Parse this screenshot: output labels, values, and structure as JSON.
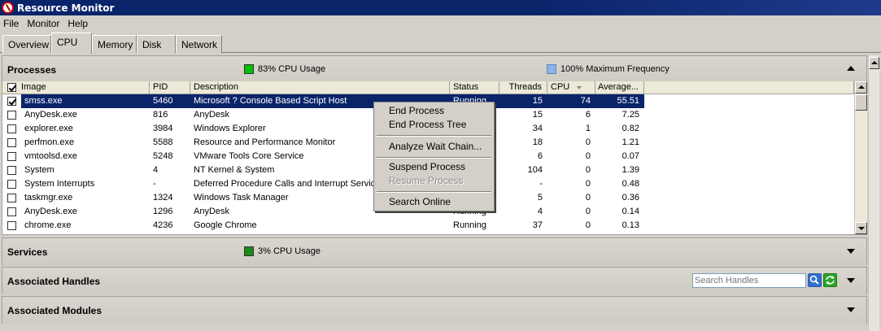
{
  "window": {
    "title": "Resource Monitor"
  },
  "menu": [
    "File",
    "Monitor",
    "Help"
  ],
  "tabs": [
    {
      "label": "Overview",
      "active": false
    },
    {
      "label": "CPU",
      "active": true
    },
    {
      "label": "Memory",
      "active": false
    },
    {
      "label": "Disk",
      "active": false
    },
    {
      "label": "Network",
      "active": false
    }
  ],
  "processes": {
    "title": "Processes",
    "cpu_usage": "83% CPU Usage",
    "cpu_usage_color": "#00c000",
    "max_frequency": "100% Maximum Frequency",
    "max_frequency_color": "#8ab4e8",
    "columns": [
      "Image",
      "PID",
      "Description",
      "Status",
      "Threads",
      "CPU",
      "Average..."
    ],
    "rows": [
      {
        "image": "smss.exe",
        "pid": "5460",
        "description": "Microsoft ? Console Based Script Host",
        "status": "Running",
        "threads": "15",
        "cpu": "74",
        "average": "55.51",
        "checked": true,
        "selected": true
      },
      {
        "image": "AnyDesk.exe",
        "pid": "816",
        "description": "AnyDesk",
        "status": "",
        "threads": "15",
        "cpu": "6",
        "average": "7.25",
        "checked": false,
        "selected": false
      },
      {
        "image": "explorer.exe",
        "pid": "3984",
        "description": "Windows Explorer",
        "status": "",
        "threads": "34",
        "cpu": "1",
        "average": "0.82",
        "checked": false,
        "selected": false
      },
      {
        "image": "perfmon.exe",
        "pid": "5588",
        "description": "Resource and Performance Monitor",
        "status": "",
        "threads": "18",
        "cpu": "0",
        "average": "1.21",
        "checked": false,
        "selected": false
      },
      {
        "image": "vmtoolsd.exe",
        "pid": "5248",
        "description": "VMware Tools Core Service",
        "status": "",
        "threads": "6",
        "cpu": "0",
        "average": "0.07",
        "checked": false,
        "selected": false
      },
      {
        "image": "System",
        "pid": "4",
        "description": "NT Kernel & System",
        "status": "",
        "threads": "104",
        "cpu": "0",
        "average": "1.39",
        "checked": false,
        "selected": false
      },
      {
        "image": "System Interrupts",
        "pid": "-",
        "description": "Deferred Procedure Calls and Interrupt Service R",
        "status": "",
        "threads": "-",
        "cpu": "0",
        "average": "0.48",
        "checked": false,
        "selected": false
      },
      {
        "image": "taskmgr.exe",
        "pid": "1324",
        "description": "Windows Task Manager",
        "status": "",
        "threads": "5",
        "cpu": "0",
        "average": "0.36",
        "checked": false,
        "selected": false
      },
      {
        "image": "AnyDesk.exe",
        "pid": "1296",
        "description": "AnyDesk",
        "status": "Running",
        "threads": "4",
        "cpu": "0",
        "average": "0.14",
        "checked": false,
        "selected": false
      },
      {
        "image": "chrome.exe",
        "pid": "4236",
        "description": "Google Chrome",
        "status": "Running",
        "threads": "37",
        "cpu": "0",
        "average": "0.13",
        "checked": false,
        "selected": false
      }
    ]
  },
  "context_menu": {
    "items": [
      {
        "label": "End Process",
        "disabled": false
      },
      {
        "label": "End Process Tree",
        "disabled": false
      },
      {
        "label": "Analyze Wait Chain...",
        "disabled": false
      },
      {
        "label": "Suspend Process",
        "disabled": false
      },
      {
        "label": "Resume Process",
        "disabled": true
      },
      {
        "label": "Search Online",
        "disabled": false
      }
    ]
  },
  "services": {
    "title": "Services",
    "cpu_usage": "3% CPU Usage",
    "cpu_usage_color": "#1a8a1a"
  },
  "handles": {
    "title": "Associated Handles",
    "search_placeholder": "Search Handles"
  },
  "modules": {
    "title": "Associated Modules"
  }
}
